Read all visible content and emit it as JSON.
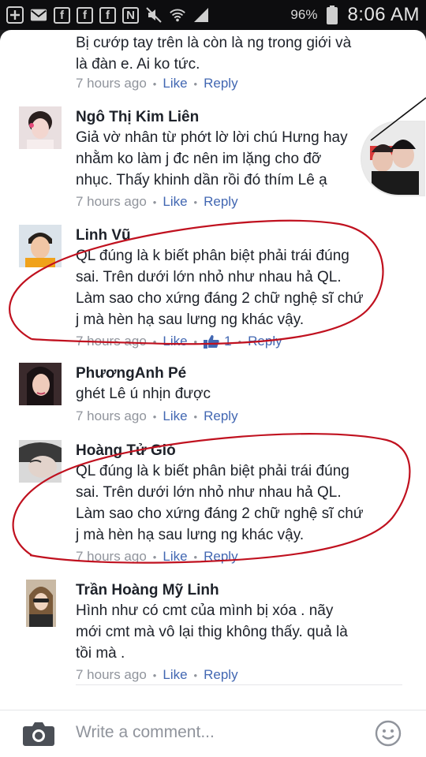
{
  "status_bar": {
    "battery": "96%",
    "time": "8:06 AM",
    "left_icons": [
      "plus-icon",
      "mail-icon",
      "facebook-icon",
      "facebook-icon",
      "facebook-icon",
      "n-icon",
      "mute-icon",
      "wifi-icon",
      "signal-icon"
    ]
  },
  "comments": [
    {
      "author": "",
      "lines": [
        "Bị cướp tay trên là còn là ng trong giới và",
        "là đàn e. Ai ko tức."
      ],
      "time": "7 hours ago",
      "like_label": "Like",
      "reply_label": "Reply"
    },
    {
      "author": "Ngô Thị Kim Liên",
      "lines": [
        "Giả vờ nhân từ phớt lờ lời chú Hưng hay",
        "nhằm ko làm j đc nên im lặng cho đỡ",
        "nhục. Thấy khinh dần rồi đó thím Lê ạ"
      ],
      "time": "7 hours ago",
      "like_label": "Like",
      "reply_label": "Reply"
    },
    {
      "author": "Linh Vũ",
      "lines": [
        "QL đúng là k biết phân biệt phải trái đúng",
        "sai. Trên dưới lớn nhỏ như nhau hả QL.",
        "Làm sao cho xứng đáng 2 chữ nghệ sĩ chứ",
        "j mà hèn hạ sau lưng ng khác vậy."
      ],
      "time": "7 hours ago",
      "like_label": "Like",
      "like_count": "1",
      "reply_label": "Reply"
    },
    {
      "author": "PhươngAnh Pé",
      "lines": [
        "ghét Lê ú nhịn được"
      ],
      "time": "7 hours ago",
      "like_label": "Like",
      "reply_label": "Reply"
    },
    {
      "author": "Hoàng Tử Gió",
      "lines": [
        "QL đúng là k biết phân biệt phải trái đúng",
        "sai. Trên dưới lớn nhỏ như nhau hả QL.",
        "Làm sao cho xứng đáng 2 chữ nghệ sĩ chứ",
        "j mà hèn hạ sau lưng ng khác vậy."
      ],
      "time": "7 hours ago",
      "like_label": "Like",
      "reply_label": "Reply"
    },
    {
      "author": "Trần Hoàng Mỹ Linh",
      "lines": [
        "Hình như có cmt của mình bị xóa . nãy",
        "mới cmt mà vô lại thig không thấy. quả là",
        "tồi mà ."
      ],
      "time": "7 hours ago",
      "like_label": "Like",
      "reply_label": "Reply"
    }
  ],
  "composer": {
    "placeholder": "Write a comment..."
  },
  "colors": {
    "link": "#4267b2",
    "meta": "#90949c",
    "text": "#1d2129",
    "annotation_circle": "#c0111f"
  }
}
